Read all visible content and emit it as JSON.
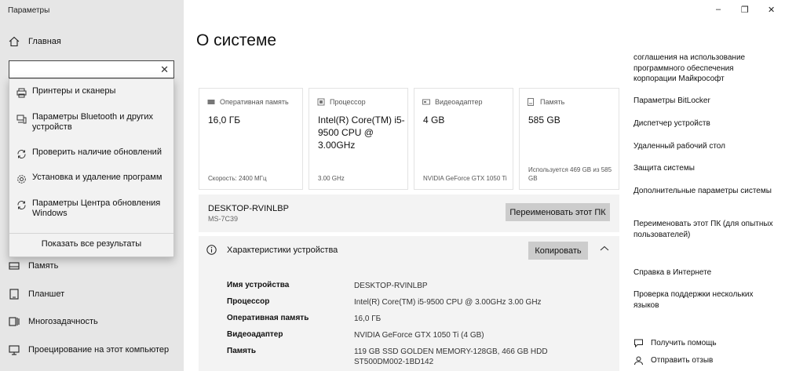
{
  "window": {
    "title": "Параметры",
    "minimize_glyph": "–",
    "maximize_glyph": "❐",
    "close_glyph": "✕"
  },
  "nav": {
    "home_label": "Главная",
    "items": [
      {
        "label": "Память",
        "icon": "storage-icon"
      },
      {
        "label": "Планшет",
        "icon": "tablet-icon"
      },
      {
        "label": "Многозадачность",
        "icon": "multitasking-icon"
      },
      {
        "label": "Проецирование на этот компьютер",
        "icon": "projection-icon"
      }
    ]
  },
  "search": {
    "value": "",
    "placeholder": "",
    "results": [
      {
        "label": "Принтеры и сканеры",
        "icon": "printer-icon"
      },
      {
        "label": "Параметры Bluetooth и других устройств",
        "icon": "devices-icon"
      },
      {
        "label": "Проверить наличие обновлений",
        "icon": "sync-icon"
      },
      {
        "label": "Установка и удаление программ",
        "icon": "gear-icon"
      },
      {
        "label": "Параметры Центра обновления Windows",
        "icon": "sync-icon"
      }
    ],
    "show_all": "Показать все результаты"
  },
  "main": {
    "title": "О системе",
    "cards": [
      {
        "title": "Оперативная память",
        "value": "16,0 ГБ",
        "sub": "Скорость: 2400 МГц",
        "icon": "ram-icon"
      },
      {
        "title": "Процессор",
        "value": "Intel(R) Core(TM) i5-9500 CPU @ 3.00GHz",
        "sub": "3.00 GHz",
        "icon": "cpu-icon"
      },
      {
        "title": "Видеоадаптер",
        "value": "4 GB",
        "sub": "NVIDIA GeForce GTX 1050 Ti",
        "icon": "gpu-icon"
      },
      {
        "title": "Память",
        "value": "585 GB",
        "sub": "Используется 469 GB из 585 GB",
        "icon": "disk-icon"
      }
    ],
    "pc": {
      "name": "DESKTOP-RVINLBP",
      "model": "MS-7C39",
      "rename_button": "Переименовать этот ПК"
    },
    "specs": {
      "title": "Характеристики устройства",
      "copy_button": "Копировать",
      "rows": [
        {
          "key": "Имя устройства",
          "value": "DESKTOP-RVINLBP"
        },
        {
          "key": "Процессор",
          "value": "Intel(R) Core(TM) i5-9500 CPU @ 3.00GHz   3.00 GHz"
        },
        {
          "key": "Оперативная память",
          "value": "16,0 ГБ"
        },
        {
          "key": "Видеоадаптер",
          "value": "NVIDIA GeForce GTX 1050 Ti (4 GB)"
        },
        {
          "key": "Память",
          "value": "119  GB  SSD  GOLDEN  MEMORY-128GB,  466  GB  HDD  ST500DM002-1BD142"
        }
      ]
    }
  },
  "related": {
    "links": [
      "соглашения на использование программного обеспечения корпорации Майкрософт",
      "Параметры BitLocker",
      "Диспетчер устройств",
      "Удаленный рабочий стол",
      "Защита системы",
      "Дополнительные параметры системы",
      "Переименовать этот ПК (для опытных пользователей)"
    ],
    "web_help_title": "Справка в Интернете",
    "web_help_links": [
      "Проверка поддержки нескольких языков"
    ],
    "get_help": "Получить помощь",
    "feedback": "Отправить отзыв"
  }
}
